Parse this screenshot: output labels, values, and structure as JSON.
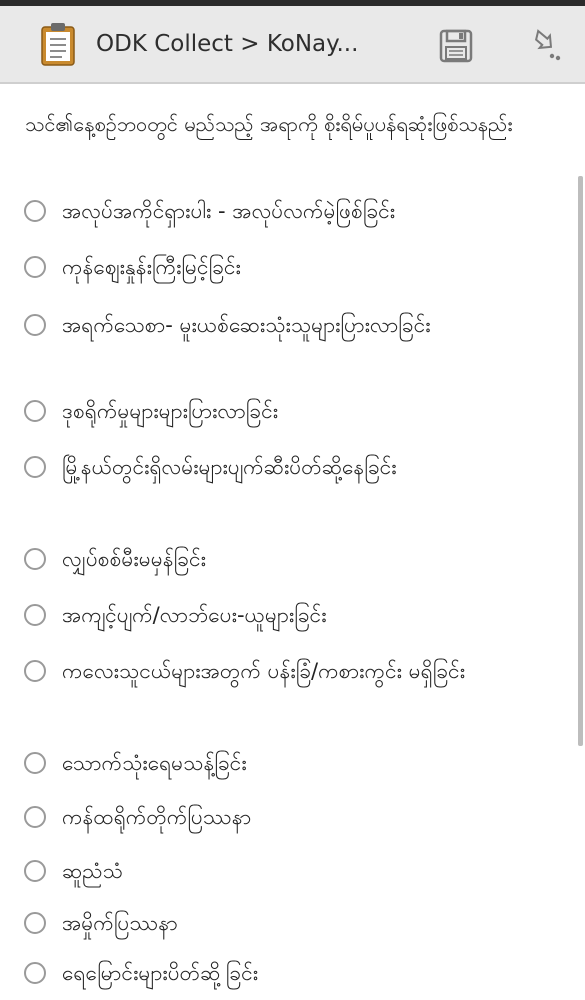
{
  "header": {
    "title": "ODK Collect > KoNay..."
  },
  "question": {
    "text": "သင်၏နေ့စဉ်ဘဝတွင် မည်သည့် အရာကို စိုးရိမ်ပူပန်ရဆုံးဖြစ်သနည်း"
  },
  "options": [
    {
      "label": "အလုပ်အကိုင်ရှားပါး - အလုပ်လက်မဲ့ဖြစ်ခြင်း"
    },
    {
      "label": "ကုန်ဈေးနှုန်းကြီးမြင့်ခြင်း"
    },
    {
      "label": "အရက်သေစာ- မူးယစ်ဆေးသုံးသူများပြားလာခြင်း"
    },
    {
      "label": "ဒုစရိုက်မှုများများပြားလာခြင်း"
    },
    {
      "label": "မြို့နယ်တွင်းရှိလမ်းများပျက်ဆီးပိတ်ဆို့နေခြင်း"
    },
    {
      "label": "လျှပ်စစ်မီးမမှန်ခြင်း"
    },
    {
      "label": "အကျင့်ပျက်/လာဘ်ပေး-ယူများခြင်း"
    },
    {
      "label": "ကလေးသူငယ်များအတွက် ပန်းခြံ/ကစားကွင်း မရှိခြင်း"
    },
    {
      "label": "သောက်သုံးရေမသန့်ခြင်း"
    },
    {
      "label": "ကန်ထရိုက်တိုက်ပြဿနာ"
    },
    {
      "label": "ဆူညံသံ"
    },
    {
      "label": "အမှိုက်ပြဿနာ"
    },
    {
      "label": "ရေမြောင်းများပိတ်ဆို့ခြင်း"
    }
  ],
  "colors": {
    "actionbar": "#e9e9e9",
    "topline": "#2b2b2b",
    "radio_border": "#9a9a9a",
    "text": "#222222"
  }
}
